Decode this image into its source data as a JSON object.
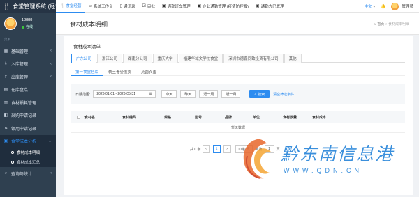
{
  "app": {
    "brand": "食堂管理系统 (经营"
  },
  "user": {
    "name": "18888",
    "status": "在线"
  },
  "sidebar": {
    "section_label": "菜单",
    "items": [
      {
        "label": "基础管理",
        "icon": "grid-icon"
      },
      {
        "label": "入库管理",
        "icon": "download-icon"
      },
      {
        "label": "出库管理",
        "icon": "upload-icon"
      },
      {
        "label": "在库盘点",
        "icon": "table-icon"
      },
      {
        "label": "食材损耗管理",
        "icon": "trash-icon"
      },
      {
        "label": "采购申请记录",
        "icon": "cart-icon"
      },
      {
        "label": "领用申请记录",
        "icon": "send-icon"
      },
      {
        "label": "食堂成本分析",
        "icon": "chart-icon"
      }
    ],
    "subitems": [
      {
        "label": "食材成本明细"
      },
      {
        "label": "食材成本汇总"
      }
    ],
    "last_item": {
      "label": "查询与统计",
      "icon": "search-icon"
    }
  },
  "topnav": {
    "items": [
      {
        "label": "食堂经营",
        "icon": "fork-icon"
      },
      {
        "label": "系统工作台",
        "icon": "desktop-icon"
      },
      {
        "label": "通讯录",
        "icon": "book-icon"
      },
      {
        "label": "审批",
        "icon": "check-icon"
      },
      {
        "label": "通勤班车管理",
        "icon": "bus-icon"
      },
      {
        "label": "企业通勤管理 (疫情防控版)",
        "icon": "bus-icon"
      },
      {
        "label": "通勤大巴管理",
        "icon": "bus-icon"
      }
    ],
    "language": "中文",
    "admin": "管理员"
  },
  "page": {
    "title": "食材成本明细",
    "breadcrumb": {
      "home": "首页",
      "current": "食材成本明细"
    }
  },
  "card": {
    "title": "食材成本清单",
    "companies": [
      "广东公司",
      "浙江公司",
      "湖南分公司",
      "重庆大学",
      "福建华域文学校食堂",
      "深圳市德鑫同致投资有限公司",
      "其他"
    ],
    "warehouses": [
      "第一食堂仓库",
      "第二食堂库房",
      "总部仓库"
    ],
    "filter": {
      "label": "日期范围:",
      "date_range": "2026-01-01 - 2026-05-31",
      "quick": [
        "今天",
        "昨天",
        "近一周",
        "近一月"
      ],
      "search": "搜索",
      "clear": "清空筛选条件"
    },
    "table": {
      "columns": [
        "食材名",
        "食材编码",
        "规格",
        "型号",
        "品牌",
        "单位",
        "食材数量",
        "食材成本"
      ],
      "empty": "暂无数据"
    },
    "pager": {
      "total": "共 0 条",
      "prev": "‹",
      "page": "1",
      "next": "›",
      "page_size": "10条/页",
      "goto_label": "到第",
      "goto_value": "1",
      "goto_unit": "页"
    }
  },
  "watermark": {
    "text": "黔东南信息港",
    "url": "WWW.QDN.CN"
  },
  "colors": {
    "primary": "#2d8cf0",
    "sidebar": "#2f4050",
    "watermark": "#3a8fdc"
  }
}
